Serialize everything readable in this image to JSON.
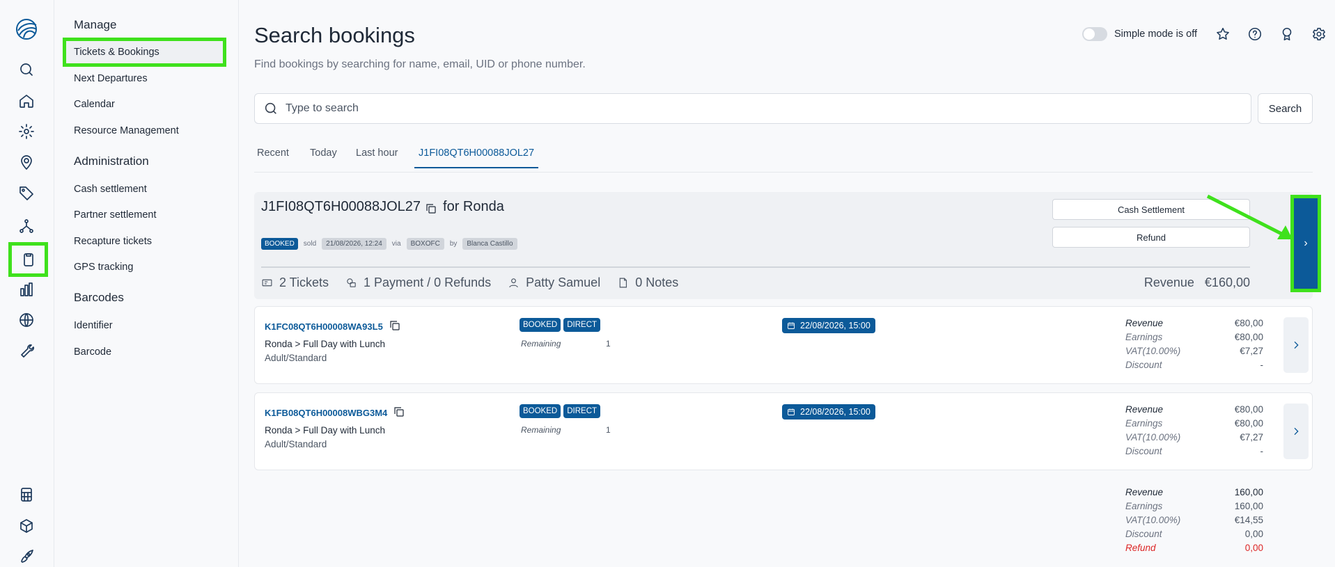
{
  "rail": {
    "icons": [
      "logo-icon",
      "search-icon",
      "home-icon",
      "gear-icon",
      "location-icon",
      "tag-icon",
      "network-icon",
      "clipboard-icon",
      "bar-chart-icon",
      "globe-icon",
      "wrench-icon",
      "calculator-icon",
      "cube-icon",
      "rocket-icon"
    ]
  },
  "submenu": {
    "manage": "Manage",
    "items_manage": [
      "Tickets & Bookings",
      "Next Departures",
      "Calendar",
      "Resource Management"
    ],
    "administration": "Administration",
    "items_admin": [
      "Cash settlement",
      "Partner settlement",
      "Recapture tickets",
      "GPS tracking"
    ],
    "barcodes": "Barcodes",
    "items_barcodes": [
      "Identifier",
      "Barcode"
    ]
  },
  "header": {
    "title": "Search bookings",
    "subtitle": "Find bookings by searching for name, email, UID or phone number.",
    "simple_mode": "Simple mode is off"
  },
  "search": {
    "placeholder": "Type to search",
    "button": "Search"
  },
  "tabs": [
    "Recent",
    "Today",
    "Last hour",
    "J1FI08QT6H00088JOL27"
  ],
  "booking": {
    "id": "J1FI08QT6H00088JOL27",
    "for_label": "for Ronda",
    "status": "BOOKED",
    "sold_label": "sold",
    "sold_date": "21/08/2026, 12:24",
    "via_label": "via",
    "via": "BOXOFC",
    "by_label": "by",
    "by": "Blanca Castillo",
    "cash_settlement": "Cash Settlement",
    "refund": "Refund",
    "open_arrow": "›",
    "tickets": "2 Tickets",
    "payments": "1 Payment / 0 Refunds",
    "customer": "Patty Samuel",
    "notes": "0 Notes",
    "revenue_label": "Revenue",
    "revenue_value": "€160,00"
  },
  "tickets": [
    {
      "id": "K1FC08QT6H00008WA93L5",
      "product": "Ronda > Full Day with Lunch",
      "type": "Adult/Standard",
      "badge1": "BOOKED",
      "badge2": "DIRECT",
      "remaining_label": "Remaining",
      "remaining": "1",
      "date": "22/08/2026, 15:00",
      "revenue_label": "Revenue",
      "revenue": "€80,00",
      "earnings_label": "Earnings",
      "earnings": "€80,00",
      "vat_label": "VAT(10.00%)",
      "vat": "€7,27",
      "discount_label": "Discount",
      "discount": "-"
    },
    {
      "id": "K1FB08QT6H00008WBG3M4",
      "product": "Ronda > Full Day with Lunch",
      "type": "Adult/Standard",
      "badge1": "BOOKED",
      "badge2": "DIRECT",
      "remaining_label": "Remaining",
      "remaining": "1",
      "date": "22/08/2026, 15:00",
      "revenue_label": "Revenue",
      "revenue": "€80,00",
      "earnings_label": "Earnings",
      "earnings": "€80,00",
      "vat_label": "VAT(10.00%)",
      "vat": "€7,27",
      "discount_label": "Discount",
      "discount": "-"
    }
  ],
  "totals": {
    "revenue_label": "Revenue",
    "revenue": "160,00",
    "earnings_label": "Earnings",
    "earnings": "160,00",
    "vat_label": "VAT(10.00%)",
    "vat": "€14,55",
    "discount_label": "Discount",
    "discount": "0,00",
    "refund_label": "Refund",
    "refund": "0,00"
  },
  "colors": {
    "accent": "#0c5a99",
    "highlight": "#3fe11c",
    "refund": "#dc2626"
  }
}
